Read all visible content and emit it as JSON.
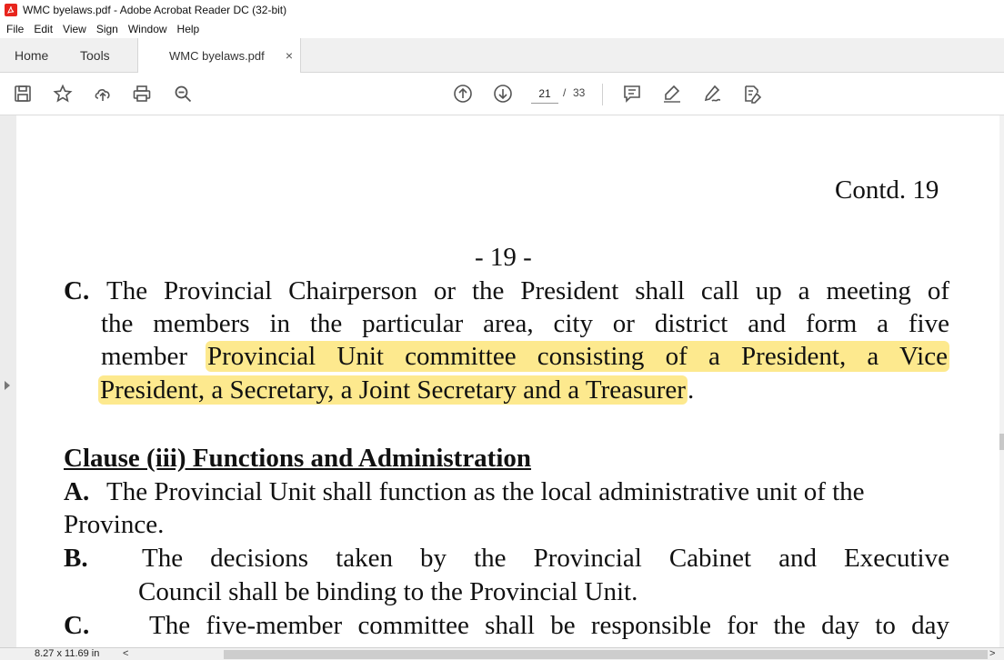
{
  "window": {
    "title": "WMC byelaws.pdf - Adobe Acrobat Reader DC (32-bit)"
  },
  "menu": [
    "File",
    "Edit",
    "View",
    "Sign",
    "Window",
    "Help"
  ],
  "tabs": {
    "home": "Home",
    "tools": "Tools",
    "document": "WMC byelaws.pdf",
    "close_glyph": "×"
  },
  "toolbar": {
    "current_page": "21",
    "separator": "/",
    "total_pages": "33",
    "icons": [
      "save-icon",
      "star-icon",
      "upload-cloud-icon",
      "print-icon",
      "zoom-search-icon",
      "arrow-up-circle-icon",
      "arrow-down-circle-icon",
      "comment-icon",
      "highlight-pen-icon",
      "sign-pen-icon",
      "edit-document-icon"
    ]
  },
  "document": {
    "contd": "Contd. 19",
    "page_number": "- 19 -",
    "para_c": {
      "marker": "C.",
      "line1": "The Provincial Chairperson or the President shall call up a meeting of",
      "line2": "the members in the particular area, city or district and form a five",
      "line3_prefix": "member",
      "line3_highlight": "Provincial Unit committee consisting of a President, a Vice",
      "line4_highlight": "President, a Secretary, a Joint Secretary and a Treasurer",
      "line4_suffix": "."
    },
    "clause_heading": "Clause (iii) Functions and Administration",
    "item_a": {
      "marker": "A.",
      "line1": "The Provincial Unit shall function as the local administrative unit of the",
      "line2": "Province."
    },
    "item_b": {
      "marker": "B.",
      "line1": "The decisions taken by the Provincial Cabinet and Executive",
      "line2": "Council shall be binding to the Provincial Unit."
    },
    "item_c": {
      "marker": "C.",
      "line1": "The five-member committee shall be responsible for the day to day"
    }
  },
  "status": {
    "page_size": "8.27 x 11.69 in",
    "scroll_left": "<",
    "scroll_right": ">"
  },
  "colors": {
    "highlight": "#fde98e",
    "acrobat_red": "#e8251d"
  }
}
